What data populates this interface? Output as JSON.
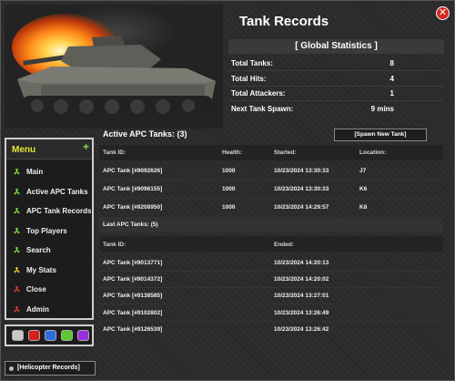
{
  "window": {
    "title": "Tank Records",
    "close_glyph": "✕"
  },
  "global_stats": {
    "header": "[ Global Statistics ]",
    "rows": [
      {
        "label": "Total Tanks:",
        "value": "8"
      },
      {
        "label": "Total Hits:",
        "value": "4"
      },
      {
        "label": "Total Attackers:",
        "value": "1"
      },
      {
        "label": "Next Tank Spawn:",
        "value": "9 mins"
      }
    ]
  },
  "active": {
    "title": "Active APC Tanks: (3)",
    "spawn_button": "[Spawn New Tank]",
    "columns": {
      "id": "Tank ID:",
      "health": "Health:",
      "started": "Started:",
      "location": "Location:"
    },
    "rows": [
      {
        "id": "APC Tank [#9092626]",
        "health": "1000",
        "started": "10/23/2024 13:30:33",
        "location": "J7"
      },
      {
        "id": "APC Tank [#9096155]",
        "health": "1000",
        "started": "10/23/2024 13:30:33",
        "location": "K6"
      },
      {
        "id": "APC Tank [#9208950]",
        "health": "1000",
        "started": "10/23/2024 14:29:57",
        "location": "K8"
      }
    ]
  },
  "last": {
    "title": "Last APC Tanks: (5)",
    "columns": {
      "id": "Tank ID:",
      "ended": "Ended:"
    },
    "rows": [
      {
        "id": "APC Tank [#9013771]",
        "ended": "10/23/2024 14:20:13"
      },
      {
        "id": "APC Tank [#9014372]",
        "ended": "10/23/2024 14:20:02"
      },
      {
        "id": "APC Tank [#9138585]",
        "ended": "10/23/2024 13:27:01"
      },
      {
        "id": "APC Tank [#9102802]",
        "ended": "10/23/2024 13:26:49"
      },
      {
        "id": "APC Tank [#9126539]",
        "ended": "10/23/2024 13:26:42"
      }
    ]
  },
  "menu": {
    "title": "Menu",
    "add_glyph": "+",
    "items": [
      {
        "label": "Main",
        "icon": "radiation-icon",
        "color": "#7fe040"
      },
      {
        "label": "Active APC Tanks",
        "icon": "radiation-icon",
        "color": "#7fe040"
      },
      {
        "label": "APC Tank Records",
        "icon": "radiation-icon",
        "color": "#7fe040"
      },
      {
        "label": "Top Players",
        "icon": "radiation-icon",
        "color": "#7fe040"
      },
      {
        "label": "Search",
        "icon": "radiation-icon",
        "color": "#7fe040"
      },
      {
        "label": "My Stats",
        "icon": "radiation-icon",
        "color": "#e8d22e"
      },
      {
        "label": "Close",
        "icon": "radiation-icon",
        "color": "#e83a2e"
      },
      {
        "label": "Admin",
        "icon": "radiation-icon",
        "color": "#e83a2e"
      }
    ]
  },
  "color_swatches": [
    "#c8c8c8",
    "#d8201a",
    "#2d6de0",
    "#5cc82e",
    "#9b2de0"
  ],
  "helicopter_button": "[Helicopter Records]"
}
